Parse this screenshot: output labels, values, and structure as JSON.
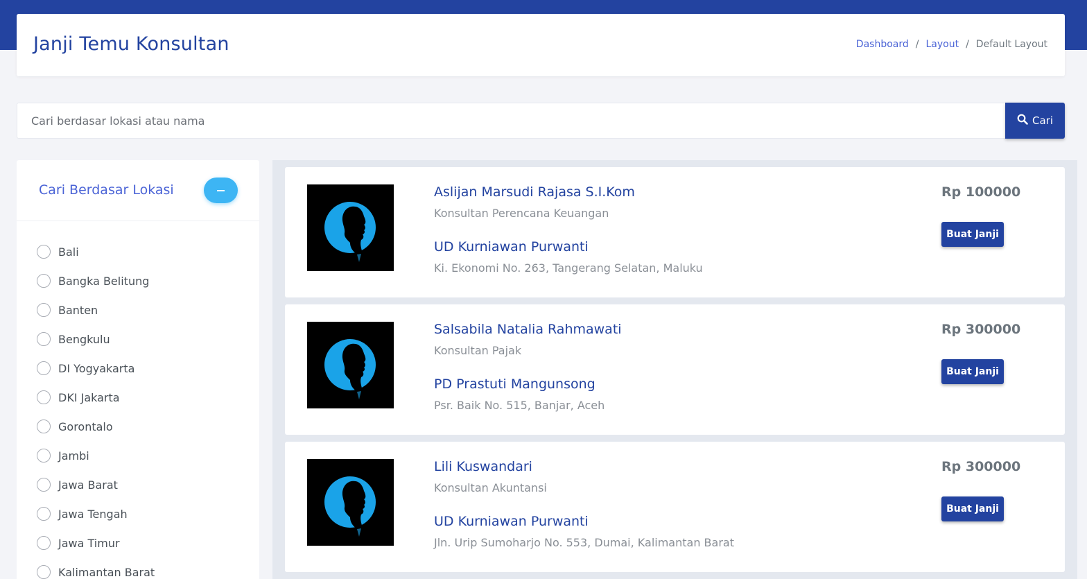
{
  "header": {
    "title": "Janji Temu Konsultan",
    "breadcrumb": [
      "Dashboard",
      "Layout",
      "Default Layout"
    ]
  },
  "search": {
    "placeholder": "Cari berdasar lokasi atau nama",
    "value": "",
    "button_label": "Cari",
    "button_icon": "search-icon"
  },
  "sidebar": {
    "title": "Cari Berdasar Lokasi",
    "collapse_icon": "minus-icon",
    "locations": [
      "Bali",
      "Bangka Belitung",
      "Banten",
      "Bengkulu",
      "DI Yogyakarta",
      "DKI Jakarta",
      "Gorontalo",
      "Jambi",
      "Jawa Barat",
      "Jawa Tengah",
      "Jawa Timur",
      "Kalimantan Barat"
    ]
  },
  "consultants": [
    {
      "name": "Aslijan Marsudi Rajasa S.I.Kom",
      "role": "Konsultan Perencana Keuangan",
      "company": "UD Kurniawan Purwanti",
      "address": "Ki. Ekonomi No. 263, Tangerang Selatan, Maluku",
      "price": "Rp 100000",
      "button_label": "Buat Janji"
    },
    {
      "name": "Salsabila Natalia Rahmawati",
      "role": "Konsultan Pajak",
      "company": "PD Prastuti Mangunsong",
      "address": "Psr. Baik No. 515, Banjar, Aceh",
      "price": "Rp 300000",
      "button_label": "Buat Janji"
    },
    {
      "name": "Lili Kuswandari",
      "role": "Konsultan Akuntansi",
      "company": "UD Kurniawan Purwanti",
      "address": "Jln. Urip Sumoharjo No. 553, Dumai, Kalimantan Barat",
      "price": "Rp 300000",
      "button_label": "Buat Janji"
    }
  ],
  "colors": {
    "primary": "#2343a0",
    "accent": "#3db5f4",
    "link": "#4a63d6",
    "background": "#f3f4f8"
  }
}
